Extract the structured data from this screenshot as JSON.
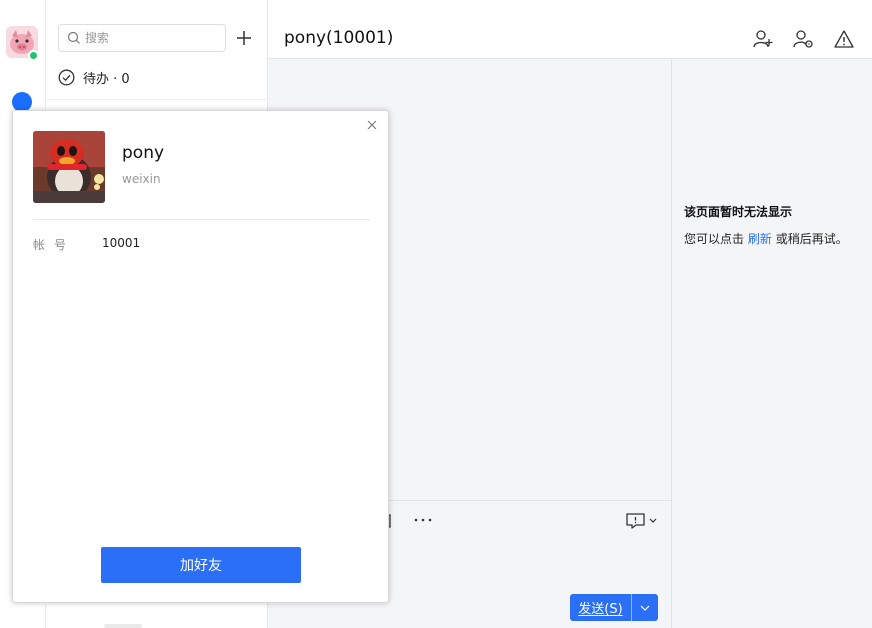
{
  "window": {
    "controls": [
      "minimize-icon",
      "maximize-icon",
      "close-icon"
    ]
  },
  "sidebar": {
    "avatar": "pig-avatar",
    "status_color": "#22c36b",
    "chat_icon_color": "#1a6fff"
  },
  "list": {
    "search_placeholder": "搜索",
    "add_icon": "plus-icon",
    "todo_label": "待办 · 0"
  },
  "chat": {
    "title": "pony(10001)",
    "header_actions": [
      "add-member-icon",
      "user-settings-icon",
      "warning-icon"
    ]
  },
  "composer": {
    "send_label": "发送(S)",
    "more_icon": "more-dots-icon",
    "message_history_icon": "chat-bubble-icon"
  },
  "side_panel": {
    "title": "该页面暂时无法显示",
    "message_prefix": "您可以点击",
    "refresh_link": "刷新",
    "message_suffix": "或稍后再试。"
  },
  "profile": {
    "name": "pony",
    "subtitle": "weixin",
    "account_label": "帐号",
    "account_value": "10001",
    "add_friend_label": "加好友"
  },
  "colors": {
    "accent": "#2a6ff5",
    "panel_bg": "#f4f5f7"
  }
}
